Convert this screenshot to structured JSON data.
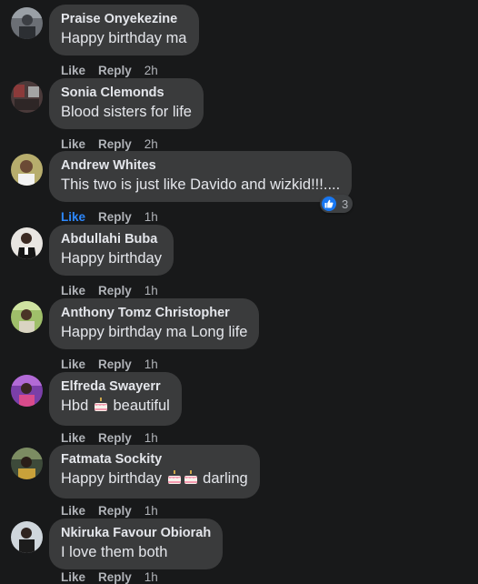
{
  "actions": {
    "like": "Like",
    "reply": "Reply"
  },
  "comments": [
    {
      "author": "Praise Onyekezine",
      "text": "Happy birthday ma",
      "time": "2h"
    },
    {
      "author": "Sonia Clemonds",
      "text": "Blood sisters for life",
      "time": "2h"
    },
    {
      "author": "Andrew Whites",
      "text": "This two is just like Davido and wizkid!!!....",
      "time": "1h",
      "liked": true,
      "reaction_count": "3"
    },
    {
      "author": "Abdullahi Buba",
      "text": "Happy birthday",
      "time": "1h"
    },
    {
      "author": "Anthony Tomz Christopher",
      "text": "Happy birthday ma Long life",
      "time": "1h"
    },
    {
      "author": "Elfreda Swayerr",
      "text_before": "Hbd",
      "text_after": "beautiful",
      "emoji": "birthday-cake",
      "time": "1h"
    },
    {
      "author": "Fatmata Sockity",
      "text_before": "Happy birthday",
      "text_after": "darling",
      "emoji": "birthday-cake x2",
      "time": "1h"
    },
    {
      "author": "Nkiruka Favour Obiorah",
      "text": "I love them both",
      "time": "1h"
    }
  ],
  "colors": {
    "background": "#18191a",
    "bubble": "#3a3b3c",
    "primary_text": "#e4e6eb",
    "secondary_text": "#b0b3b8",
    "like_active": "#2d88ff"
  }
}
